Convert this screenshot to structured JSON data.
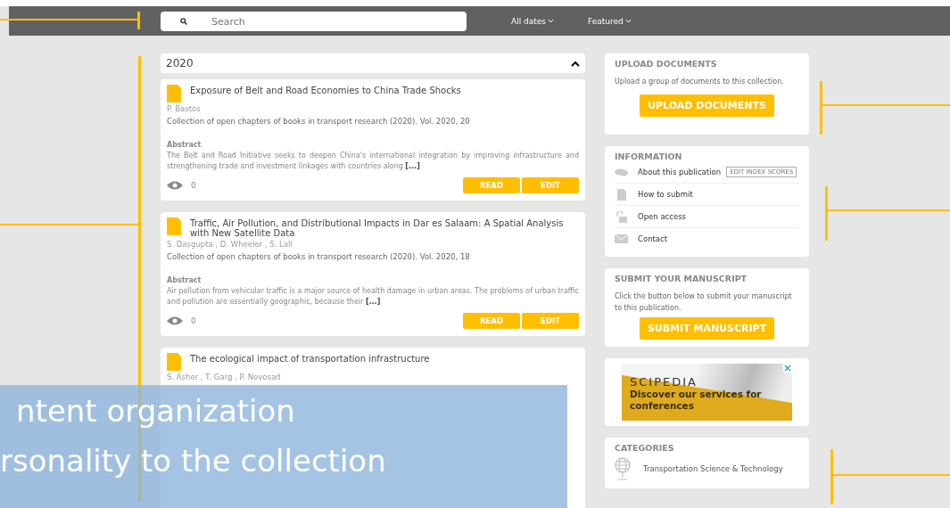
{
  "header": {
    "search": {
      "placeholder": "Search"
    },
    "filters": [
      {
        "label": "All dates"
      },
      {
        "label": "Featured"
      }
    ]
  },
  "group": {
    "title": "2020",
    "expanded": true
  },
  "articles": [
    {
      "title": "Exposure of Belt and Road Economies to China Trade Shocks",
      "authors": "P. Bastos",
      "source": "Collection of open chapters of books in transport research (2020). Vol. 2020, 20",
      "abstract_label": "Abstract",
      "abstract": "The Belt and Road Initiative seeks to deepen China's international integration by improving infrastructure and strengthening trade and investment linkages with countries along",
      "more": "[...]",
      "views": "0",
      "actions": [
        "READ",
        "EDIT"
      ]
    },
    {
      "title": "Traffic, Air Pollution, and Distributional Impacts in Dar es Salaam: A Spatial Analysis with New Satellite Data",
      "authors": "S. Dasgupta , D. Wheeler , S. Lall",
      "source": "Collection of open chapters of books in transport research (2020). Vol. 2020, 18",
      "abstract_label": "Abstract",
      "abstract": "Air pollution from vehicular traffic is a major source of health damage in urban areas. The problems of urban traffic and pollution are essentially geographic, because their",
      "more": "[...]",
      "views": "0",
      "actions": [
        "READ",
        "EDIT"
      ]
    },
    {
      "title": "The ecological impact of transportation infrastructure",
      "authors": "S. Asher , T. Garg , P. Novosad"
    }
  ],
  "sidebar": {
    "upload": {
      "heading": "UPLOAD DOCUMENTS",
      "text": "Upload a group of documents to this collection.",
      "button": "UPLOAD DOCUMENTS"
    },
    "information": {
      "heading": "INFORMATION",
      "items": [
        {
          "kind": "about",
          "label": "About this publication",
          "badge": "EDIT INDEX SCORES"
        },
        {
          "kind": "submit",
          "label": "How to submit"
        },
        {
          "kind": "access",
          "label": "Open access"
        },
        {
          "kind": "contact",
          "label": "Contact"
        }
      ]
    },
    "manuscript": {
      "heading": "SUBMIT YOUR MANUSCRIPT",
      "text": "Click the button below to submit your manuscript to this publication.",
      "button": "SUBMIT MANUSCRIPT"
    },
    "ad": {
      "brand": "SCIPEDIA",
      "tagline": "Discover our services for conferences"
    },
    "categories": {
      "heading": "CATEGORIES",
      "items": [
        "Transportation Science & Technology"
      ]
    }
  },
  "annotation": {
    "lines": [
      "ntent organization",
      "rsonality to the collection"
    ]
  }
}
